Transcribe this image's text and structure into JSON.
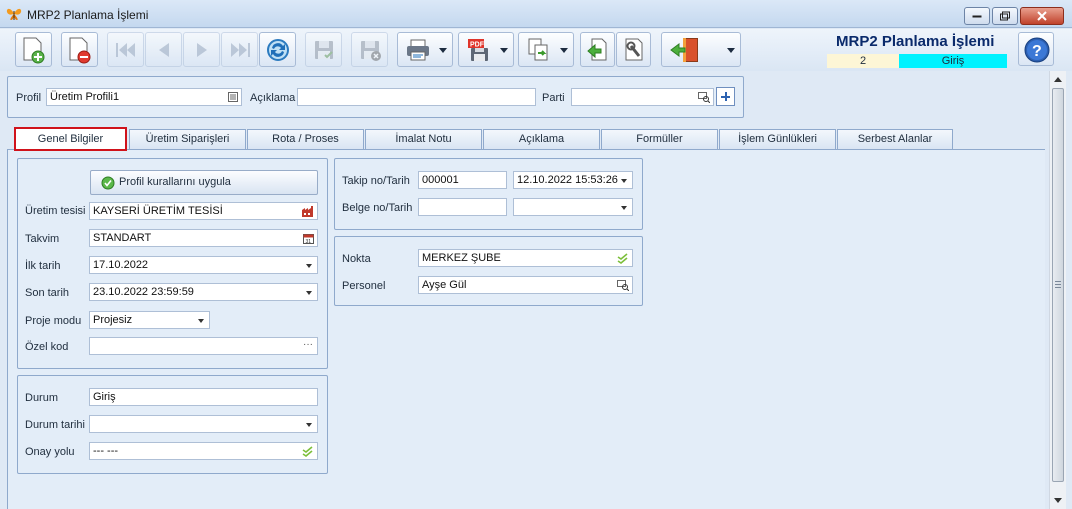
{
  "window": {
    "title": "MRP2 Planlama İşlemi"
  },
  "header": {
    "title": "MRP2 Planlama İşlemi",
    "number": "2",
    "status": "Giriş",
    "status_color": "#00f2ff"
  },
  "toolbar": {
    "buttons": [
      "new-document-icon",
      "delete-document-icon",
      "first-record-icon",
      "previous-record-icon",
      "next-record-icon",
      "last-record-icon",
      "refresh-icon",
      "save-icon",
      "save-close-icon",
      "print-icon",
      "pdf-export-icon",
      "copy-transfer-icon",
      "import-icon",
      "settings-tools-icon",
      "exit-icon",
      "help-icon"
    ]
  },
  "profile": {
    "profil_label": "Profil",
    "profil_value": "Üretim Profili1",
    "aciklama_label": "Açıklama",
    "aciklama_value": "",
    "parti_label": "Parti",
    "parti_value": ""
  },
  "tabs": [
    {
      "label": "Genel Bilgiler"
    },
    {
      "label": "Üretim Siparişleri"
    },
    {
      "label": "Rota / Proses"
    },
    {
      "label": "İmalat Notu"
    },
    {
      "label": "Açıklama"
    },
    {
      "label": "Formüller"
    },
    {
      "label": "İşlem Günlükleri"
    },
    {
      "label": "Serbest Alanlar"
    }
  ],
  "general": {
    "apply_button": "Profil kurallarını uygula",
    "uretim_tesisi_label": "Üretim tesisi",
    "uretim_tesisi": "KAYSERİ ÜRETİM TESİSİ",
    "takvim_label": "Takvim",
    "takvim": "STANDART",
    "ilk_tarih_label": "İlk tarih",
    "ilk_tarih": "17.10.2022",
    "son_tarih_label": "Son tarih",
    "son_tarih": "23.10.2022 23:59:59",
    "proje_modu_label": "Proje modu",
    "proje_modu": "Projesiz",
    "ozel_kod_label": "Özel kod",
    "ozel_kod": ""
  },
  "status_section": {
    "durum_label": "Durum",
    "durum": "Giriş",
    "durum_tarihi_label": "Durum tarihi",
    "durum_tarihi": "",
    "onay_yolu_label": "Onay yolu",
    "onay_yolu": "--- ---"
  },
  "tracking": {
    "takip_label": "Takip no/Tarih",
    "takip_no": "000001",
    "takip_tarih": "12.10.2022 15:53:26",
    "belge_label": "Belge no/Tarih",
    "belge_no": "",
    "belge_tarih": ""
  },
  "location": {
    "nokta_label": "Nokta",
    "nokta": "MERKEZ ŞUBE",
    "personel_label": "Personel",
    "personel": "Ayşe Gül"
  }
}
